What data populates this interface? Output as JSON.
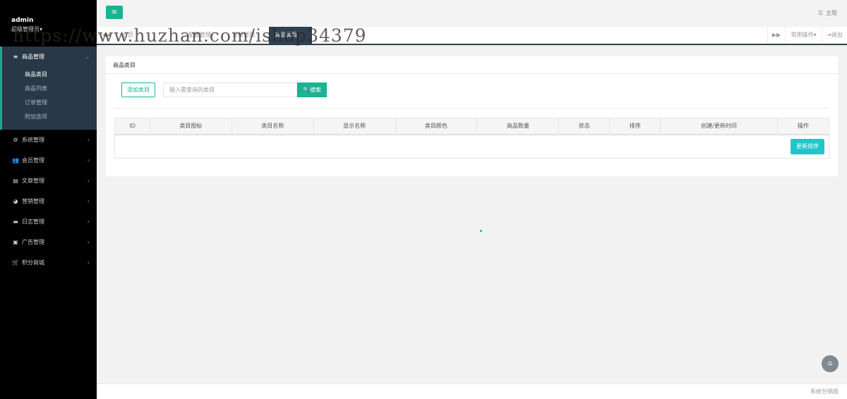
{
  "profile": {
    "name": "admin",
    "role": "超级管理员",
    "role_caret": "▾"
  },
  "sidebar": {
    "groups": [
      {
        "label": "商品管理",
        "icon": "bars-icon",
        "glyph": "≡",
        "chev": "⌄",
        "sub": [
          {
            "label": "商品类目"
          },
          {
            "label": "商品列表"
          },
          {
            "label": "订单管理"
          },
          {
            "label": "附加选项"
          }
        ]
      },
      {
        "label": "系统管理",
        "icon": "gear-icon",
        "glyph": "⚙",
        "chev": "‹"
      },
      {
        "label": "会员管理",
        "icon": "users-icon",
        "glyph": "👥",
        "chev": "‹"
      },
      {
        "label": "文章管理",
        "icon": "file-icon",
        "glyph": "▤",
        "chev": "‹"
      },
      {
        "label": "营销管理",
        "icon": "pie-chart-icon",
        "glyph": "◕",
        "chev": "‹"
      },
      {
        "label": "日志管理",
        "icon": "list-icon",
        "glyph": "▬",
        "chev": "‹"
      },
      {
        "label": "广告管理",
        "icon": "image-icon",
        "glyph": "▣",
        "chev": "‹"
      },
      {
        "label": "积分商城",
        "icon": "cart-icon",
        "glyph": "🛒",
        "chev": "‹"
      }
    ]
  },
  "topbar": {
    "menu_glyph": "≡",
    "theme_label": "主题",
    "theme_glyph": "☰"
  },
  "tabs": {
    "back_glyph": "◀◀",
    "items": [
      {
        "label": "首页"
      },
      {
        "label": "配置管理"
      },
      {
        "label": "订单管理"
      },
      {
        "label": "商品类目"
      }
    ],
    "forward_glyph": "▶▶",
    "common_ops": "常用操作▾",
    "logout": "⇥退出"
  },
  "watermark": "https://www.huzhan.com/ishop34379",
  "panel": {
    "title": "商品类目",
    "add_button": "添加类目",
    "search_placeholder": "输入需查询的类目",
    "search_button": "搜索",
    "search_glyph": "🔍"
  },
  "table": {
    "columns": [
      "ID",
      "类目图标",
      "类目名称",
      "显示名称",
      "类目颜色",
      "商品数量",
      "状态",
      "排序",
      "创建/更新时间",
      "操作"
    ],
    "update_sort_button": "更新排序"
  },
  "home_glyph": "⌂",
  "footer": {
    "text": "系统分销版"
  }
}
